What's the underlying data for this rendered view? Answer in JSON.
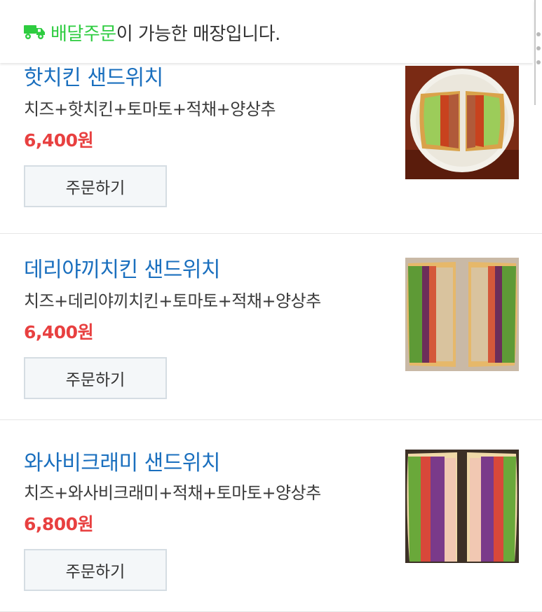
{
  "banner": {
    "highlight": "배달주문",
    "text": "이 가능한 매장입니다.",
    "icon": "delivery-truck-icon",
    "highlight_color": "#2ecc40"
  },
  "menu_items": [
    {
      "name": "핫치킨 샌드위치",
      "description": "치즈+핫치킨+토마토+적채+양상추",
      "price": "6,400원",
      "button": "주문하기"
    },
    {
      "name": "데리야끼치킨 샌드위치",
      "description": "치즈+데리야끼치킨+토마토+적채+양상추",
      "price": "6,400원",
      "button": "주문하기"
    },
    {
      "name": "와사비크래미 샌드위치",
      "description": "치즈+와사비크래미+적채+토마토+양상추",
      "price": "6,800원",
      "button": "주문하기"
    }
  ],
  "colors": {
    "name": "#1a6fbe",
    "price": "#e84040"
  }
}
